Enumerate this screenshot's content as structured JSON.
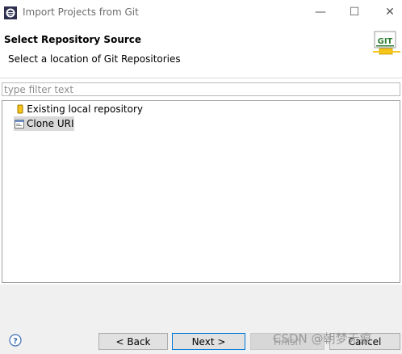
{
  "window": {
    "title": "Import Projects from Git",
    "minimize_glyph": "—",
    "maximize_glyph": "☐",
    "close_glyph": "✕"
  },
  "banner": {
    "title": "Select Repository Source",
    "description": "Select a location of Git Repositories",
    "logo_text": "GIT"
  },
  "filter": {
    "placeholder": "type filter text",
    "value": ""
  },
  "tree": {
    "items": [
      {
        "label": "Existing local repository",
        "icon": "repository-icon",
        "selected": false
      },
      {
        "label": "Clone URI",
        "icon": "clone-uri-icon",
        "selected": true
      }
    ]
  },
  "buttons": {
    "help_icon": "help-icon",
    "back": "< Back",
    "next": "Next >",
    "finish": "Finish",
    "cancel": "Cancel"
  },
  "watermark": "CSDN @朝梦无痕",
  "colors": {
    "accent": "#0078d7",
    "selection": "#d9d9d9",
    "footer_bg": "#f0f0f0",
    "git_logo_green": "#2e7d32",
    "git_logo_yellow": "#f5c518"
  }
}
